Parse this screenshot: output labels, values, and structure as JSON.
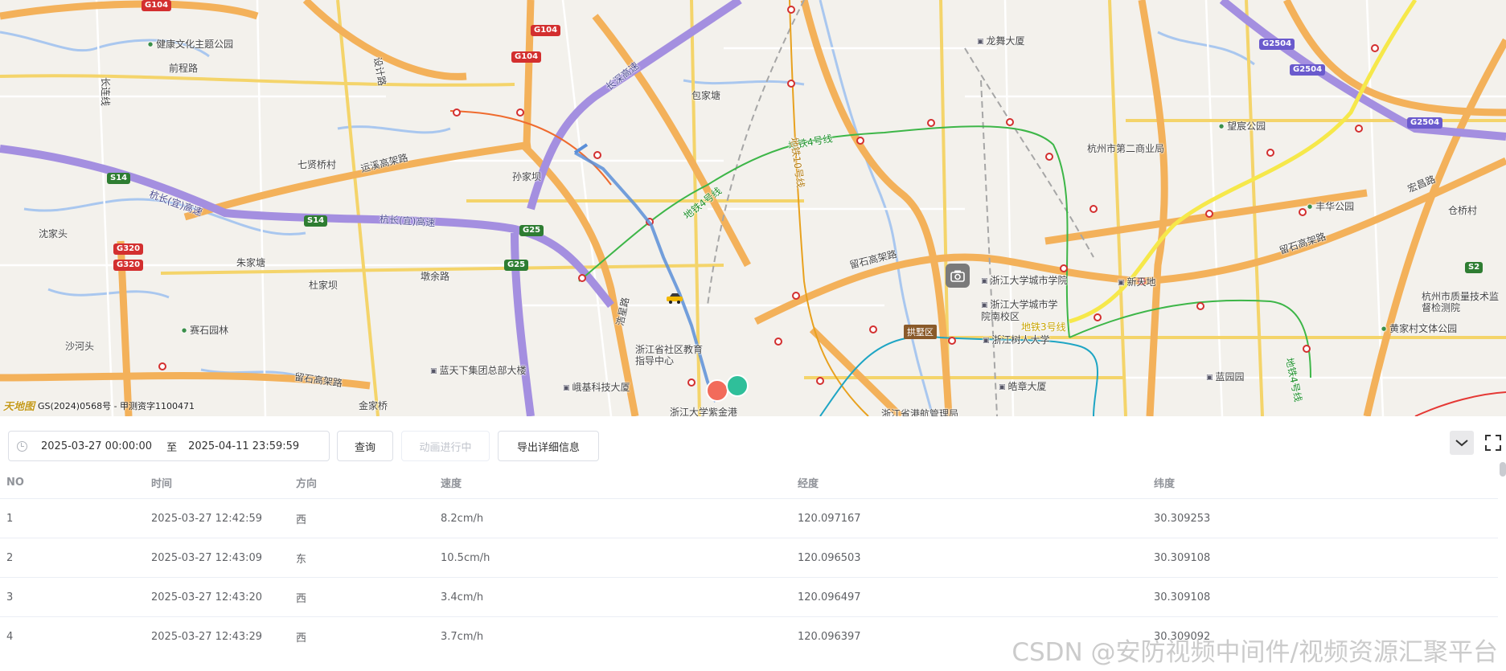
{
  "map": {
    "labels": {
      "jiankang": "健康文化主题公园",
      "qiancheng": "前程路",
      "changlian": "长连线",
      "sheji": "设计路",
      "baojiatang": "包家塘",
      "longxiang": "龙舞大厦",
      "qixianqiao": "七贤桥村",
      "yunqu": "运溪高架路",
      "sunjiaba": "孙家坝",
      "shenjiatou": "沈家头",
      "zhujiatang": "朱家塘",
      "dujiaba": "杜家坝",
      "dunyu": "墩余路",
      "saishiyuan": "赛石园林",
      "shaheitou": "沙河头",
      "jinjiaqiao": "金家桥",
      "lantian": "蓝天下集团总部大楼",
      "dianji": "峨基科技大厦",
      "jiaoyu": "浙江省社区教育指导中心",
      "zijingang": "浙江大学紫金港",
      "haoxing": "浩星路",
      "hangchang1": "杭长(宜)高速",
      "hangchang2": "杭长(宜)高速",
      "changshen": "长深高速",
      "metro4a": "地铁4号线",
      "metro4b": "地铁4号线",
      "metro10": "地铁10号线",
      "metro3": "地铁3号线",
      "metro4c": "地铁4号线",
      "liushi1": "留石高架路",
      "liushi2": "留石高架路",
      "liushi3": "留石高架路",
      "zjcity": "浙江大学城市学院",
      "zjcity2": "浙江大学城市学院南校区",
      "zjshuren": "浙江树人大学",
      "haozhang": "皓章大厦",
      "xintiandi": "新天地",
      "langyuan": "蓝园园",
      "dierbaihuo": "杭州市第二商业局",
      "wangchen": "望宸公园",
      "fenghua": "丰华公园",
      "hongchang": "宏昌路",
      "cangqiao": "仓桥村",
      "zhiliang": "杭州市质量技术监督检测院",
      "huangjiacun": "黄家村文体公园",
      "hanggang": "浙江省港航管理局"
    },
    "shields": {
      "g104a": "G104",
      "g104b": "G104",
      "g104c": "G104",
      "s14": "S14",
      "s14b": "S14",
      "g25": "G25",
      "g25b": "G25",
      "g320": "G320",
      "g320b": "G320",
      "g2504a": "G2504",
      "g2504b": "G2504",
      "g2504c": "G2504",
      "s2": "S2"
    },
    "district": "拱墅区",
    "copyright": "GS(2024)0568号 - 甲测资字1100471",
    "logo": "天地图",
    "camera_icon": "camera-icon",
    "start_marker_color": "#f26b5b",
    "end_marker_color": "#2fbf9a",
    "track_color": "#5b8fd8"
  },
  "toolbar": {
    "start_time": "2025-03-27 00:00:00",
    "separator": "至",
    "end_time": "2025-04-11 23:59:59",
    "query_label": "查询",
    "animate_label": "动画进行中",
    "export_label": "导出详细信息",
    "collapse_icon": "chevron-down-icon",
    "fullscreen_icon": "fullscreen-icon"
  },
  "table": {
    "headers": [
      "NO",
      "时间",
      "方向",
      "速度",
      "经度",
      "纬度"
    ],
    "rows": [
      [
        "1",
        "2025-03-27 12:42:59",
        "西",
        "8.2cm/h",
        "120.097167",
        "30.309253"
      ],
      [
        "2",
        "2025-03-27 12:43:09",
        "东",
        "10.5cm/h",
        "120.096503",
        "30.309108"
      ],
      [
        "3",
        "2025-03-27 12:43:20",
        "西",
        "3.4cm/h",
        "120.096497",
        "30.309108"
      ],
      [
        "4",
        "2025-03-27 12:43:29",
        "西",
        "3.7cm/h",
        "120.096397",
        "30.309092"
      ]
    ]
  },
  "watermark": "CSDN @安防视频中间件/视频资源汇聚平台"
}
